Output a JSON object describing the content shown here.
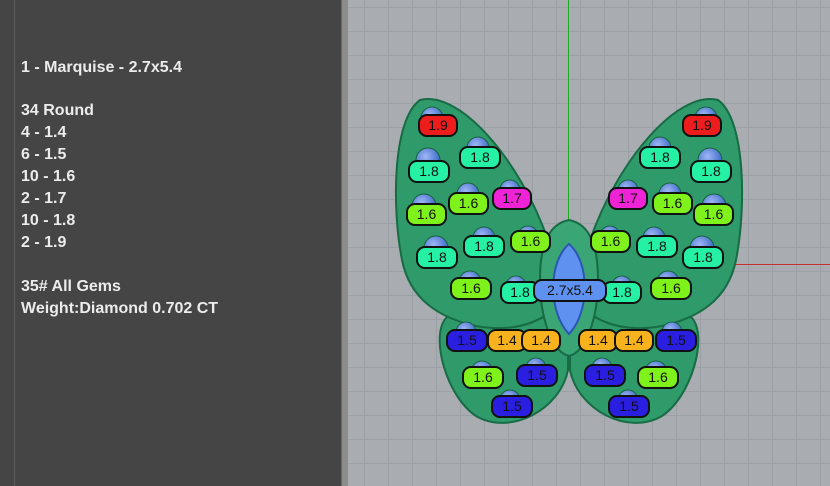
{
  "info": {
    "marquise": "1 - Marquise - 2.7x5.4",
    "round_header": "34 Round",
    "round_counts": [
      "4 - 1.4",
      "6 - 1.5",
      "10 - 1.6",
      "2 - 1.7",
      "10 - 1.8",
      "2 - 1.9"
    ],
    "total": "35# All Gems",
    "weight": "Weight:Diamond 0.702 CT"
  },
  "gem_labels": [
    "1.9",
    "1.9",
    "1.8",
    "1.8",
    "1.8",
    "1.8",
    "1.7",
    "1.7",
    "1.6",
    "1.6",
    "1.6",
    "1.6",
    "1.6",
    "1.6",
    "1.8",
    "1.8",
    "1.8",
    "1.8",
    "1.6",
    "1.6",
    "1.8",
    "1.8",
    "2.7x5.4",
    "1.5",
    "1.4",
    "1.4",
    "1.4",
    "1.4",
    "1.5",
    "1.6",
    "1.5",
    "1.5",
    "1.6",
    "1.5",
    "1.5"
  ],
  "colors": {
    "size_1_4": "#f7b21e",
    "size_1_5": "#2a1ee0",
    "size_1_6": "#7ef21a",
    "size_1_7": "#ef23d6",
    "size_1_8": "#25f0a4",
    "size_1_9": "#ee1d1d",
    "marquise": "#5f92f0",
    "ring_body": "#2f9a6a"
  }
}
